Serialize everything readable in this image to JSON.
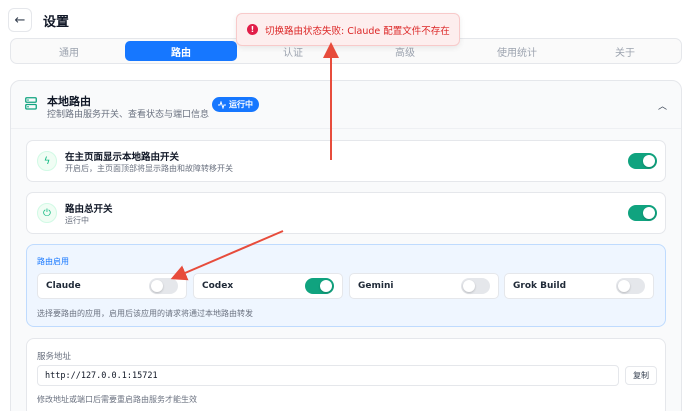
{
  "header": {
    "title": "设置",
    "back_icon": "arrow-left-icon"
  },
  "tabs": [
    {
      "label": "通用",
      "active": false
    },
    {
      "label": "路由",
      "active": true
    },
    {
      "label": "认证",
      "active": false
    },
    {
      "label": "高级",
      "active": false
    },
    {
      "label": "使用统计",
      "active": false
    },
    {
      "label": "关于",
      "active": false
    }
  ],
  "toast": {
    "text": "切换路由状态失败: Claude 配置文件不存在",
    "icon": "error-icon",
    "color": "#dc2626"
  },
  "local_routing": {
    "title": "本地路由",
    "subtitle": "控制路由服务开关、查看状态与端口信息",
    "status_badge": "运行中",
    "show_switch": {
      "title": "在主页面显示本地路由开关",
      "subtitle": "开启后，主页面顶部将显示路由和故障转移开关",
      "enabled": true
    },
    "master_switch": {
      "title": "路由总开关",
      "subtitle": "运行中",
      "enabled": true
    },
    "apps": {
      "label": "路由启用",
      "items": [
        {
          "name": "Claude",
          "enabled": false
        },
        {
          "name": "Codex",
          "enabled": true
        },
        {
          "name": "Gemini",
          "enabled": false
        },
        {
          "name": "Grok Build",
          "enabled": false
        }
      ],
      "hint": "选择要路由的应用，启用后该应用的请求将通过本地路由转发"
    },
    "service_address": {
      "label": "服务地址",
      "value": "http://127.0.0.1:15721",
      "copy_label": "复制",
      "hint": "修改地址或端口后需要重启路由服务才能生效"
    }
  },
  "colors": {
    "accent": "#1677ff",
    "toggle_on": "#10a37f",
    "error": "#dc2626",
    "annotation": "#e74c3c"
  }
}
